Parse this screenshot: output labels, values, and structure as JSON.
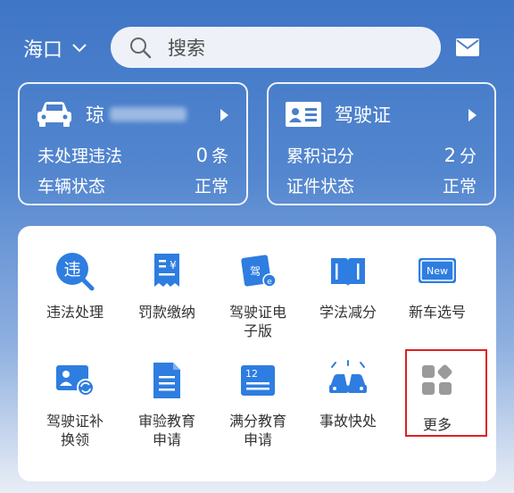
{
  "header": {
    "city": "海口",
    "search_placeholder": "搜索"
  },
  "vehicle_card": {
    "plate_prefix": "琼",
    "row1_label": "未处理违法",
    "row1_value": "0",
    "row1_unit": "条",
    "row2_label": "车辆状态",
    "row2_value": "正常"
  },
  "license_card": {
    "title": "驾驶证",
    "row1_label": "累积记分",
    "row1_value": "2",
    "row1_unit": "分",
    "row2_label": "证件状态",
    "row2_value": "正常"
  },
  "services": [
    {
      "label": "违法处理",
      "icon": "violation-icon"
    },
    {
      "label": "罚款缴纳",
      "icon": "fine-payment-icon"
    },
    {
      "label": "驾驶证电子版",
      "icon": "e-license-icon"
    },
    {
      "label": "学法减分",
      "icon": "study-book-icon"
    },
    {
      "label": "新车选号",
      "icon": "new-plate-icon"
    },
    {
      "label": "驾驶证补换领",
      "icon": "license-renew-icon"
    },
    {
      "label": "审验教育申请",
      "icon": "document-icon"
    },
    {
      "label": "满分教育申请",
      "icon": "calendar-icon"
    },
    {
      "label": "事故快处",
      "icon": "accident-icon"
    },
    {
      "label": "更多",
      "icon": "more-grid-icon"
    }
  ],
  "colors": {
    "brand_blue": "#3f76c6",
    "icon_blue": "#2e7de0",
    "highlight_red": "#e02020"
  }
}
